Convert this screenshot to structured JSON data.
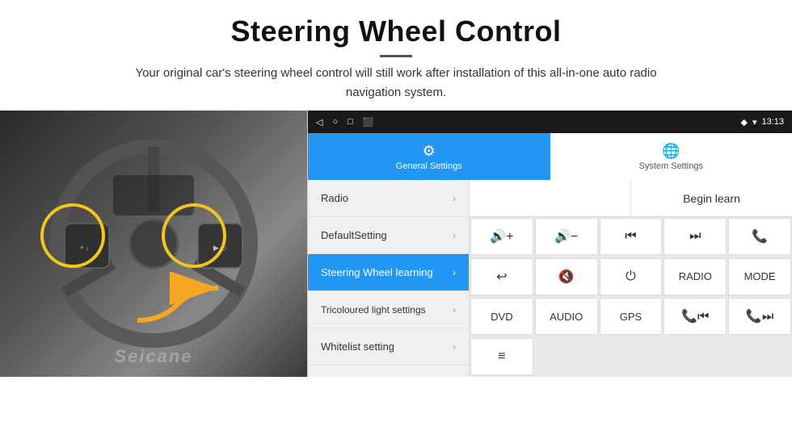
{
  "header": {
    "title": "Steering Wheel Control",
    "description": "Your original car's steering wheel control will still work after installation of this all-in-one auto radio navigation system."
  },
  "status_bar": {
    "back_icon": "◁",
    "home_icon": "○",
    "recent_icon": "□",
    "screenshot_icon": "⬛",
    "gps_icon": "◆",
    "wifi_icon": "▾",
    "time": "13:13"
  },
  "tabs": [
    {
      "label": "General Settings",
      "icon": "⚙",
      "active": true
    },
    {
      "label": "System Settings",
      "icon": "🌐",
      "active": false
    }
  ],
  "menu_items": [
    {
      "label": "Radio",
      "active": false
    },
    {
      "label": "DefaultSetting",
      "active": false
    },
    {
      "label": "Steering Wheel learning",
      "active": true
    },
    {
      "label": "Tricoloured light settings",
      "active": false
    },
    {
      "label": "Whitelist setting",
      "active": false
    }
  ],
  "begin_learn_label": "Begin learn",
  "control_buttons": [
    {
      "label": "🔊+",
      "row": 1,
      "col": 1
    },
    {
      "label": "🔊−",
      "row": 1,
      "col": 2
    },
    {
      "label": "⏮",
      "row": 1,
      "col": 3
    },
    {
      "label": "⏭",
      "row": 1,
      "col": 4
    },
    {
      "label": "📞",
      "row": 1,
      "col": 5
    },
    {
      "label": "↩",
      "row": 2,
      "col": 1
    },
    {
      "label": "🔇×",
      "row": 2,
      "col": 2
    },
    {
      "label": "⏻",
      "row": 2,
      "col": 3
    },
    {
      "label": "RADIO",
      "row": 2,
      "col": 4
    },
    {
      "label": "MODE",
      "row": 2,
      "col": 5
    },
    {
      "label": "DVD",
      "row": 3,
      "col": 1
    },
    {
      "label": "AUDIO",
      "row": 3,
      "col": 2
    },
    {
      "label": "GPS",
      "row": 3,
      "col": 3
    },
    {
      "label": "📞⏮",
      "row": 3,
      "col": 4
    },
    {
      "label": "📞⏭",
      "row": 3,
      "col": 5
    },
    {
      "label": "≡",
      "row": 4,
      "col": 1
    }
  ],
  "seicane_text": "Seicane"
}
